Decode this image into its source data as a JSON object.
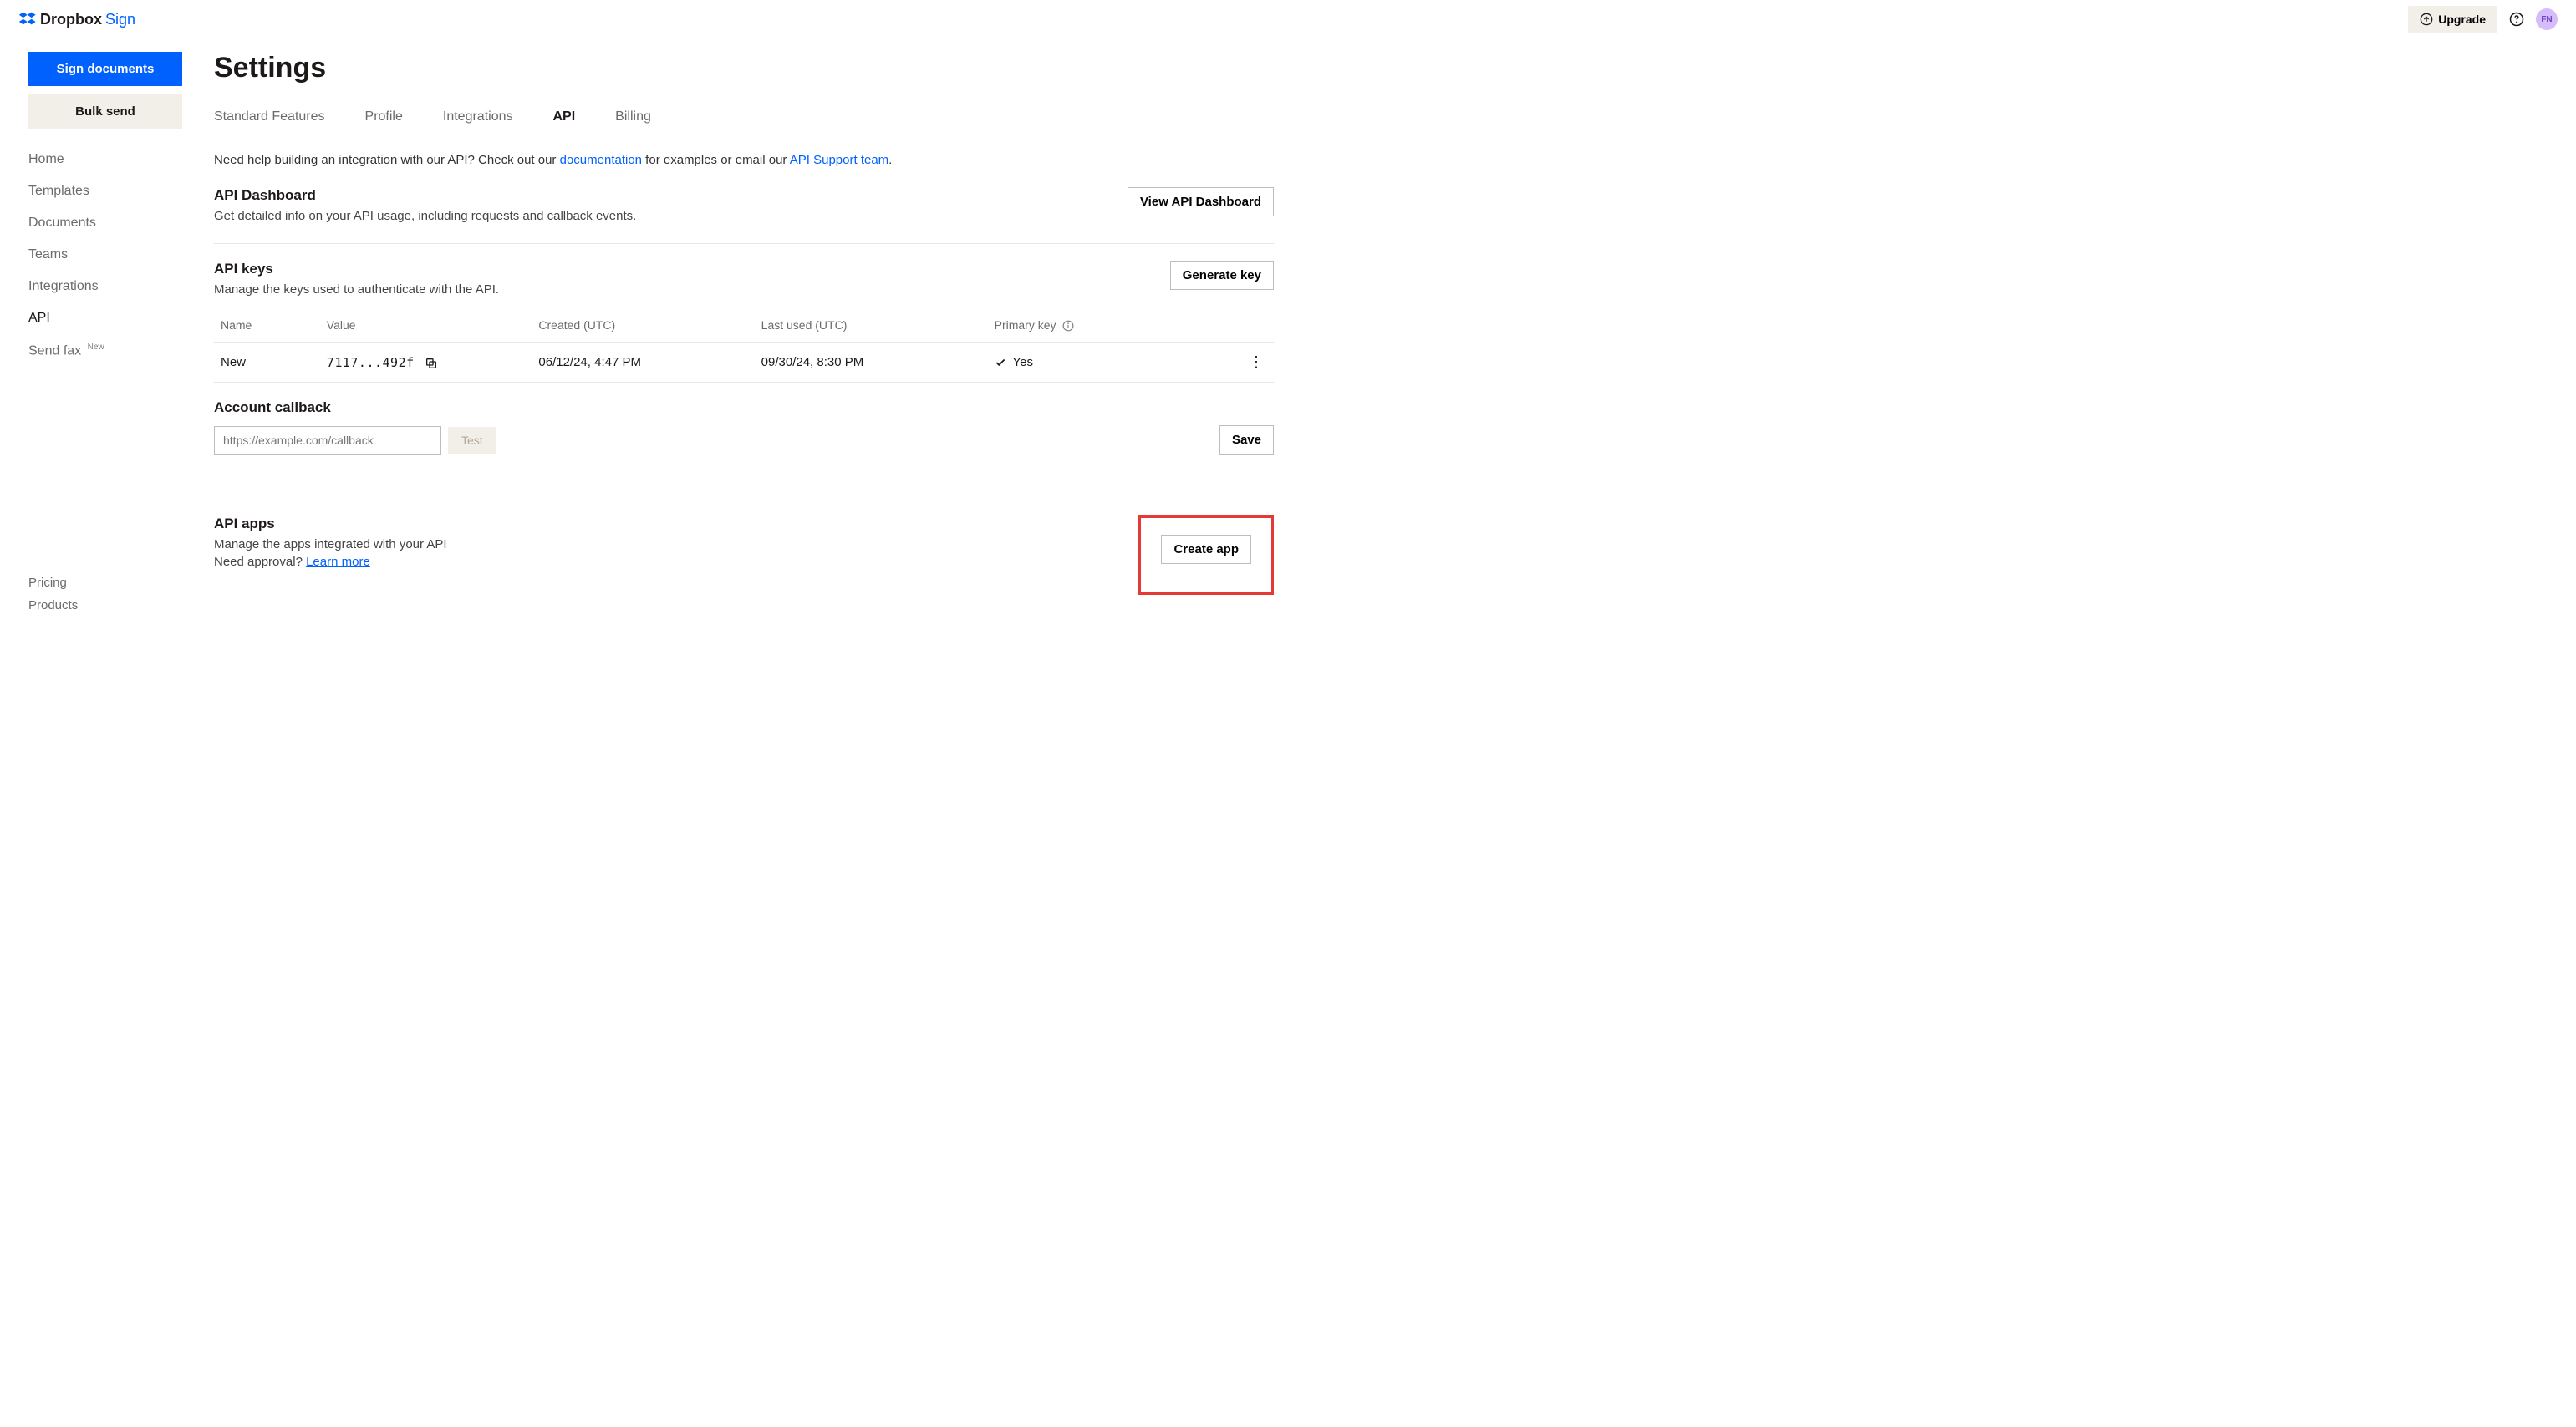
{
  "brand": {
    "dropbox": "Dropbox",
    "sign": "Sign"
  },
  "topbar": {
    "upgrade": "Upgrade",
    "avatar": "FN"
  },
  "sidebar": {
    "primary_btn": "Sign documents",
    "secondary_btn": "Bulk send",
    "nav": [
      "Home",
      "Templates",
      "Documents",
      "Teams",
      "Integrations",
      "API",
      "Send fax"
    ],
    "send_fax_badge": "New",
    "footer": [
      "Pricing",
      "Products"
    ]
  },
  "page": {
    "title": "Settings",
    "tabs": [
      "Standard Features",
      "Profile",
      "Integrations",
      "API",
      "Billing"
    ],
    "help_pre": "Need help building an integration with our API? Check out our ",
    "help_doc": "documentation",
    "help_mid": " for examples or email our ",
    "help_team": "API Support team",
    "help_post": "."
  },
  "dash": {
    "title": "API Dashboard",
    "desc": "Get detailed info on your API usage, including requests and callback events.",
    "btn": "View API Dashboard"
  },
  "keys": {
    "title": "API keys",
    "desc": "Manage the keys used to authenticate with the API.",
    "btn": "Generate key",
    "headers": {
      "name": "Name",
      "value": "Value",
      "created": "Created (UTC)",
      "last": "Last used (UTC)",
      "primary": "Primary key"
    },
    "rows": [
      {
        "name": "New",
        "value": "7117...492f",
        "created": "06/12/24, 4:47 PM",
        "last": "09/30/24, 8:30 PM",
        "primary": "Yes"
      }
    ]
  },
  "callback": {
    "title": "Account callback",
    "placeholder": "https://example.com/callback",
    "test": "Test",
    "save": "Save"
  },
  "apps": {
    "title": "API apps",
    "desc": "Manage the apps integrated with your API",
    "approval_pre": "Need approval? ",
    "approval_link": "Learn more",
    "btn": "Create app"
  }
}
